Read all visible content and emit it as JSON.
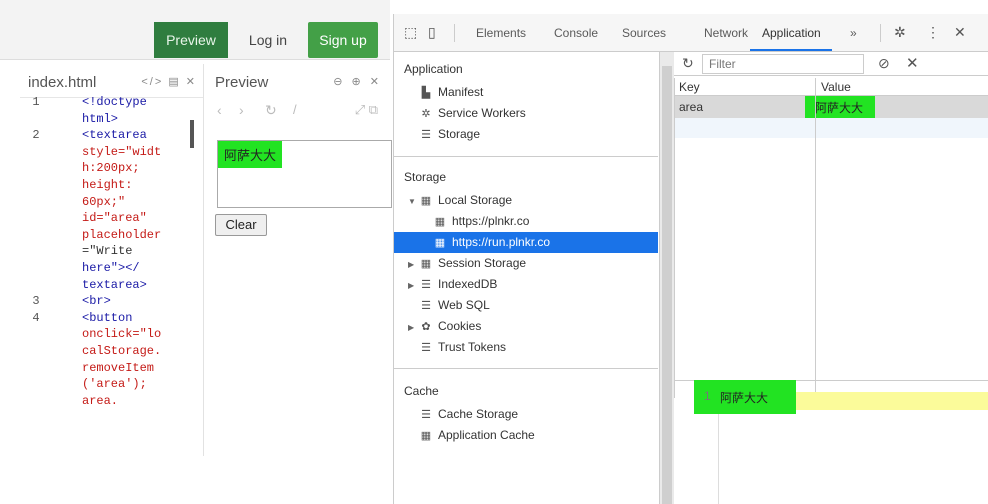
{
  "plunker": {
    "topbar": {
      "preview": "Preview",
      "login": "Log in",
      "signup": "Sign up"
    },
    "editor": {
      "filename": "index.html",
      "tools": "</> ▤ ✕",
      "lines": [
        {
          "n": "1",
          "t": "<!doctype"
        },
        {
          "n": "",
          "t": "html>"
        },
        {
          "n": "2",
          "t": "<textarea"
        },
        {
          "n": "",
          "t": "style=\"widt"
        },
        {
          "n": "",
          "t": "h:200px;"
        },
        {
          "n": "",
          "t": "height:"
        },
        {
          "n": "",
          "t": "60px;\""
        },
        {
          "n": "",
          "t": "id=\"area\""
        },
        {
          "n": "",
          "t": "placeholder"
        },
        {
          "n": "",
          "t": "=\"Write"
        },
        {
          "n": "",
          "t": "here\"></"
        },
        {
          "n": "",
          "t": "textarea>"
        },
        {
          "n": "3",
          "t": "<br>"
        },
        {
          "n": "4",
          "t": "<button"
        },
        {
          "n": "",
          "t": "onclick=\"lo"
        },
        {
          "n": "",
          "t": "calStorage."
        },
        {
          "n": "",
          "t": "removeItem"
        },
        {
          "n": "",
          "t": "('area');"
        },
        {
          "n": "",
          "t": "area."
        }
      ]
    },
    "preview": {
      "title": "Preview",
      "tools": "⊖ ⊕ ✕",
      "nav": {
        "back": "‹",
        "forward": "›",
        "reload": "↻",
        "url": "/",
        "fullscreen": "⤢ ⧉"
      },
      "textarea_value": "阿萨大大",
      "clear_button": "Clear"
    }
  },
  "devtools": {
    "tabs": [
      "Elements",
      "Console",
      "Sources",
      "Network",
      "Application",
      "»"
    ],
    "active_tab": "Application",
    "sidebar": {
      "application": {
        "title": "Application",
        "items": [
          "Manifest",
          "Service Workers",
          "Storage"
        ]
      },
      "storage": {
        "title": "Storage",
        "local_storage": "Local Storage",
        "local_children": [
          "https://plnkr.co",
          "https://run.plnkr.co"
        ],
        "items": [
          "Session Storage",
          "IndexedDB",
          "Web SQL",
          "Cookies",
          "Trust Tokens"
        ]
      },
      "cache": {
        "title": "Cache",
        "items": [
          "Cache Storage",
          "Application Cache"
        ]
      }
    },
    "filter_placeholder": "Filter",
    "table": {
      "columns": [
        "Key",
        "Value"
      ],
      "rows": [
        {
          "key": "area",
          "value": "阿萨大大"
        }
      ]
    },
    "detail": {
      "line_number": "1",
      "value": "阿萨大大"
    }
  }
}
